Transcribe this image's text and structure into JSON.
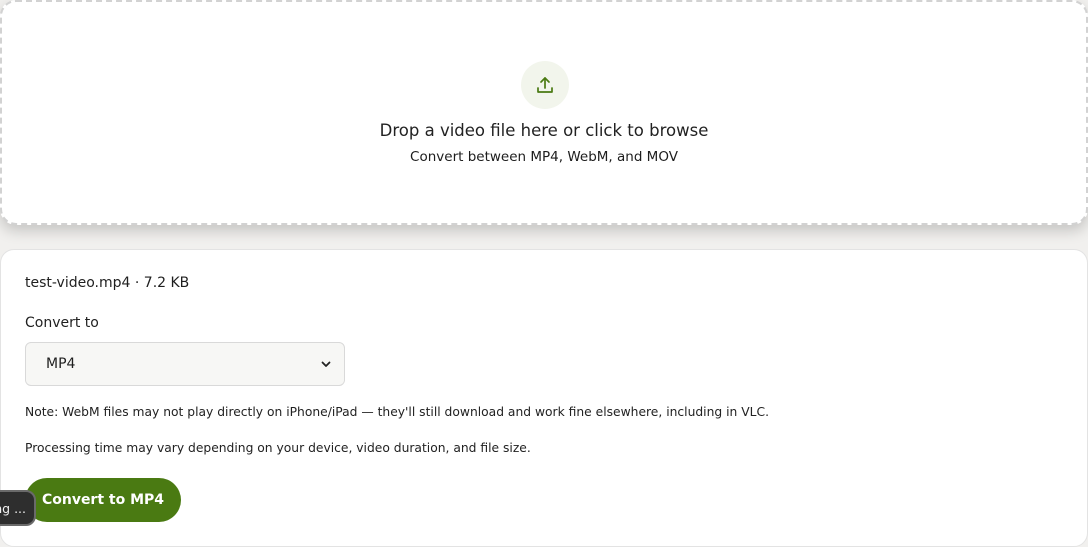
{
  "dropzone": {
    "icon": "upload-icon",
    "title": "Drop a video file here or click to browse",
    "subtitle": "Convert between MP4, WebM, and MOV"
  },
  "file": {
    "info": "test-video.mp4 · 7.2 KB"
  },
  "convert": {
    "label": "Convert to",
    "selected": "MP4",
    "options": [
      "MP4"
    ]
  },
  "notes": {
    "webm": "Note: WebM files may not play directly on iPhone/iPad — they'll still download and work fine elsewhere, including in VLC.",
    "processing": "Processing time may vary depending on your device, video duration, and file size."
  },
  "button": {
    "label": "Convert to MP4"
  },
  "toast": {
    "text": "ng ..."
  },
  "colors": {
    "accent": "#4a7a12",
    "icon": "#4a7a12",
    "icon_bg": "#f2f5ec"
  }
}
